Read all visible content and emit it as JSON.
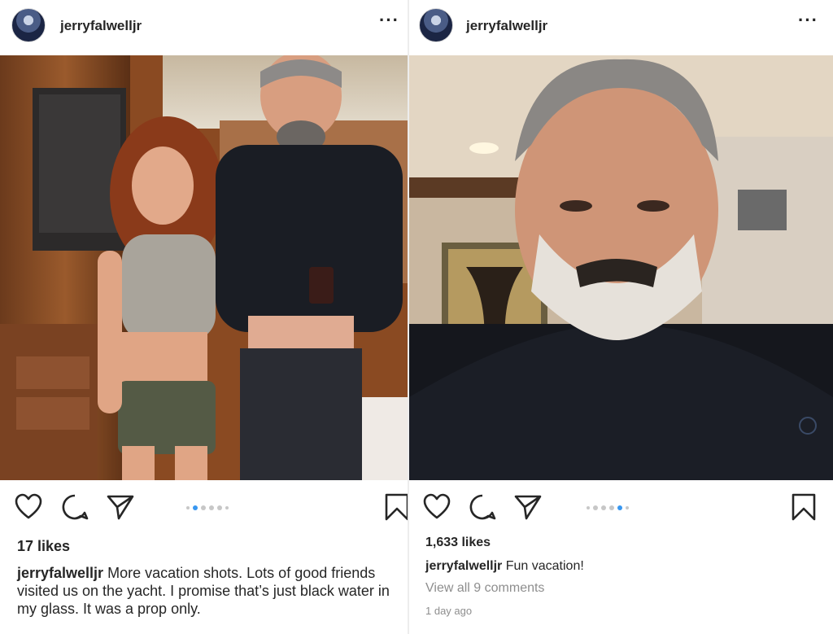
{
  "left_post": {
    "username": "jerryfalwelljr",
    "more_icon": "ellipsis-icon",
    "likes": "17 likes",
    "caption_user": "jerryfalwelljr",
    "caption_text": "More vacation shots.  Lots of good friends visited us on the yacht.  I promise that’s just black water in my glass.  It was a prop only.",
    "carousel_active_index": 1,
    "carousel_count": 6
  },
  "right_post": {
    "username": "jerryfalwelljr",
    "more_icon": "ellipsis-icon",
    "likes": "1,633 likes",
    "caption_user": "jerryfalwelljr",
    "caption_text": "Fun vacation!",
    "comments_link": "View all 9 comments",
    "timestamp": "1 day ago",
    "carousel_active_index": 3,
    "carousel_count": 6
  },
  "icons": [
    "heart-icon",
    "comment-icon",
    "share-icon",
    "bookmark-icon"
  ],
  "colors": {
    "accent": "#3897f0",
    "text": "#262626",
    "muted": "#8e8e8e"
  }
}
